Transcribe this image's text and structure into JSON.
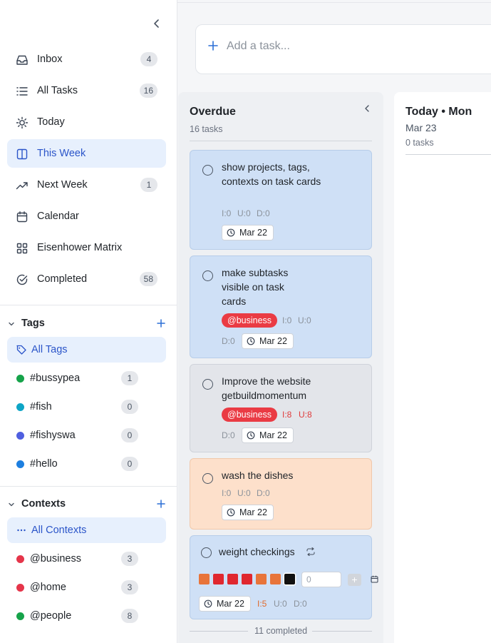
{
  "sidebar": {
    "nav": [
      {
        "label": "Inbox",
        "count": "4",
        "icon": "inbox-icon"
      },
      {
        "label": "All Tasks",
        "count": "16",
        "icon": "list-icon"
      },
      {
        "label": "Today",
        "count": "",
        "icon": "sun-icon"
      },
      {
        "label": "This Week",
        "count": "",
        "icon": "week-icon"
      },
      {
        "label": "Next Week",
        "count": "1",
        "icon": "trend-icon"
      },
      {
        "label": "Calendar",
        "count": "",
        "icon": "calendar-icon"
      },
      {
        "label": "Eisenhower Matrix",
        "count": "",
        "icon": "grid-icon"
      },
      {
        "label": "Completed",
        "count": "58",
        "icon": "check-circle-icon"
      }
    ],
    "tags": {
      "title": "Tags",
      "all_label": "All Tags",
      "items": [
        {
          "label": "#bussypea",
          "count": "1",
          "color": "#16a34a"
        },
        {
          "label": "#fish",
          "count": "0",
          "color": "#0ea5c6"
        },
        {
          "label": "#fishyswa",
          "count": "0",
          "color": "#4f5fe0"
        },
        {
          "label": "#hello",
          "count": "0",
          "color": "#1d7fe0"
        }
      ]
    },
    "contexts": {
      "title": "Contexts",
      "all_label": "All Contexts",
      "items": [
        {
          "label": "@business",
          "count": "3",
          "color": "#e5354a"
        },
        {
          "label": "@home",
          "count": "3",
          "color": "#e5354a"
        },
        {
          "label": "@people",
          "count": "8",
          "color": "#16a34a"
        }
      ]
    }
  },
  "add_task": {
    "placeholder": "Add a task..."
  },
  "columns": {
    "overdue": {
      "title": "Overdue",
      "subtitle": "16 tasks",
      "completed_label": "11 completed"
    },
    "today": {
      "title": "Today • Mon",
      "date": "Mar 23",
      "subtitle": "0 tasks"
    }
  },
  "tasks": [
    {
      "title": "show projects, tags, contexts on task cards",
      "i": "I:0",
      "u": "U:0",
      "d": "D:0",
      "date": "Mar 22",
      "context": ""
    },
    {
      "title": "make subtasks visible on task cards",
      "i": "I:0",
      "u": "U:0",
      "d": "D:0",
      "date": "Mar 22",
      "context": "@business"
    },
    {
      "title": "Improve the website getbuildmomentum",
      "i": "I:8",
      "u": "U:8",
      "d": "D:0",
      "date": "Mar 22",
      "context": "@business"
    },
    {
      "title": "wash the dishes",
      "i": "I:0",
      "u": "U:0",
      "d": "D:0",
      "date": "Mar 22",
      "context": ""
    },
    {
      "title": "weight checkings",
      "i": "I:5",
      "u": "U:0",
      "d": "D:0",
      "date": "Mar 22",
      "context": "",
      "input_value": "0",
      "add_label": "+",
      "habit_colors": [
        "#e8743a",
        "#e0272f",
        "#e0272f",
        "#e0272f",
        "#e8743a",
        "#e8743a",
        "#111111"
      ]
    }
  ],
  "colors": {
    "accent": "#2b55c9",
    "active_bg": "#e7f0fd",
    "context_red": "#ea3b44"
  }
}
